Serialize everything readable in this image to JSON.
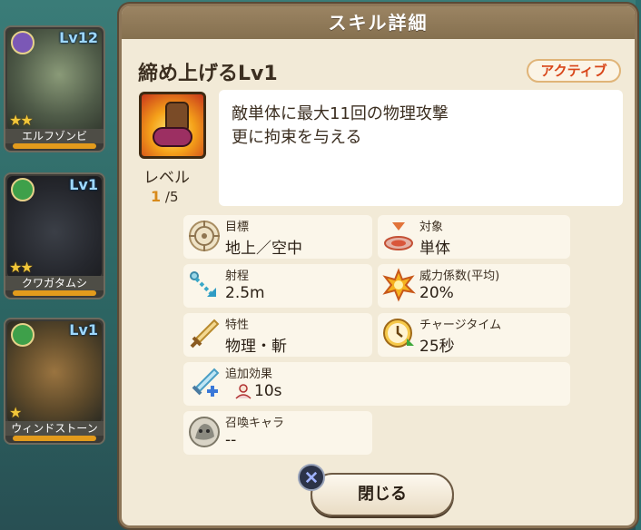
{
  "background_cards": [
    {
      "level": "Lv12",
      "name": "エルフゾンビ",
      "stars": "★★"
    },
    {
      "level": "Lv1",
      "name": "クワガタムシ",
      "stars": "★★"
    },
    {
      "level": "Lv1",
      "name": "ウィンドストーン",
      "stars": "★"
    }
  ],
  "dialog": {
    "title": "スキル詳細",
    "skill_name": "締め上げるLv1",
    "skill_type": "アクティブ",
    "level_label": "レベル",
    "level_current": "1",
    "level_max": "/5",
    "description": [
      "敵単体に最大11回の物理攻撃",
      "更に拘束を与える"
    ],
    "stats": {
      "target": {
        "label": "目標",
        "value": "地上／空中"
      },
      "subject": {
        "label": "対象",
        "value": "単体"
      },
      "range": {
        "label": "射程",
        "value": "2.5m"
      },
      "power": {
        "label": "威力係数(平均)",
        "value": "20%"
      },
      "trait": {
        "label": "特性",
        "value": "物理・斬"
      },
      "charge": {
        "label": "チャージタイム",
        "value": "25秒"
      },
      "effect": {
        "label": "追加効果",
        "value": "10s"
      },
      "summon": {
        "label": "召喚キャラ",
        "value": "--"
      }
    },
    "close_label": "閉じる"
  },
  "colors": {
    "accent_orange": "#d8461a",
    "level_gold": "#d88a1a",
    "header_brown": "#8d7658"
  }
}
